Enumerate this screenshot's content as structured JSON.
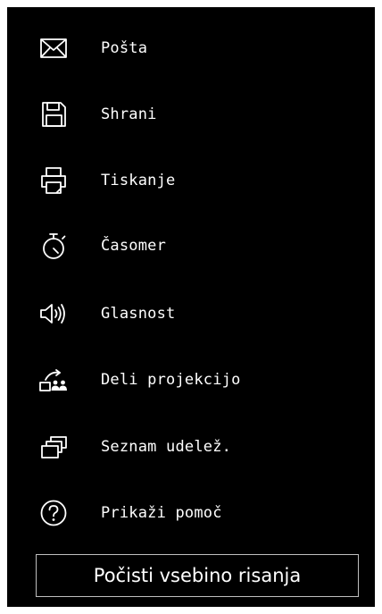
{
  "menu": {
    "items": [
      {
        "label": "Pošta",
        "icon": "mail-icon"
      },
      {
        "label": "Shrani",
        "icon": "save-icon"
      },
      {
        "label": "Tiskanje",
        "icon": "printer-icon"
      },
      {
        "label": "Časomer",
        "icon": "stopwatch-icon"
      },
      {
        "label": "Glasnost",
        "icon": "speaker-volume-icon"
      },
      {
        "label": "Deli projekcijo",
        "icon": "share-screen-icon"
      },
      {
        "label": "Seznam udelež.",
        "icon": "windows-stack-icon"
      },
      {
        "label": "Prikaži pomoč",
        "icon": "help-icon"
      }
    ]
  },
  "clear_button": {
    "label": "Počisti vsebino risanja"
  },
  "colors": {
    "background": "#000000",
    "foreground": "#ffffff",
    "button_border": "#bfbfbf"
  }
}
